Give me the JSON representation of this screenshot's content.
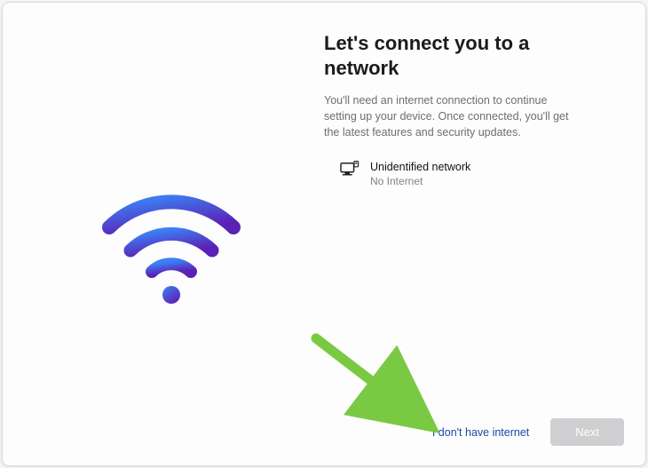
{
  "heading": "Let's connect you to a network",
  "subtext": "You'll need an internet connection to continue setting up your device. Once connected, you'll get the latest features and security updates.",
  "network": {
    "name": "Unidentified network",
    "status": "No Internet"
  },
  "footer": {
    "skip_label": "I don't have internet",
    "next_label": "Next"
  },
  "colors": {
    "wifi_grad_start": "#3b82f6",
    "wifi_grad_end": "#6d28d9",
    "arrow": "#7ac943"
  }
}
